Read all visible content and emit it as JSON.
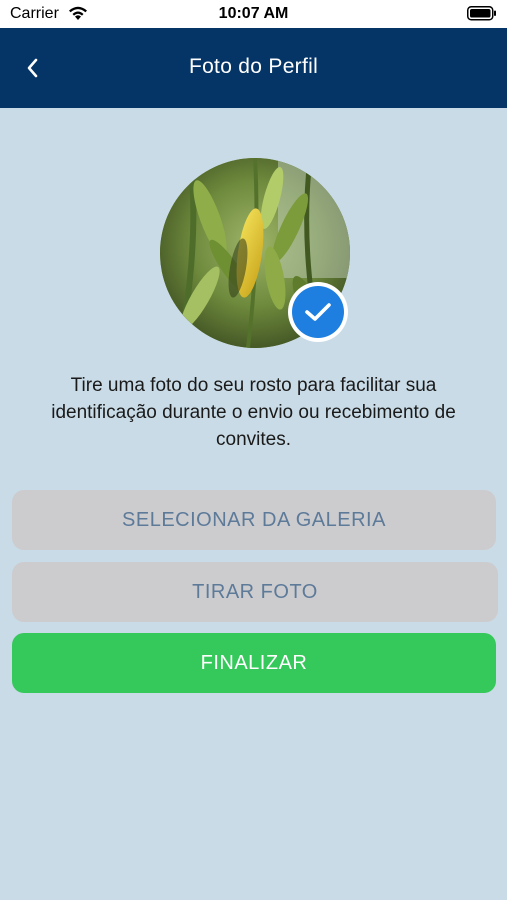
{
  "status_bar": {
    "carrier": "Carrier",
    "time": "10:07 AM"
  },
  "header": {
    "title": "Foto do Perfil",
    "back_icon": "chevron-left-icon"
  },
  "profile": {
    "photo_icon": "profile-photo",
    "badge_icon": "checkmark-icon"
  },
  "description": "Tire uma foto do seu rosto para facilitar sua identificação durante o envio ou recebimento de convites.",
  "buttons": {
    "gallery_label": "SELECIONAR DA GALERIA",
    "photo_label": "TIRAR FOTO",
    "finish_label": "FINALIZAR"
  },
  "colors": {
    "header_bg": "#053566",
    "page_bg": "#c9dbe6",
    "secondary_button_bg": "#cccccf",
    "secondary_button_text": "#5d7a99",
    "primary_button_bg": "#35c85a",
    "check_badge": "#1e7fe0"
  }
}
